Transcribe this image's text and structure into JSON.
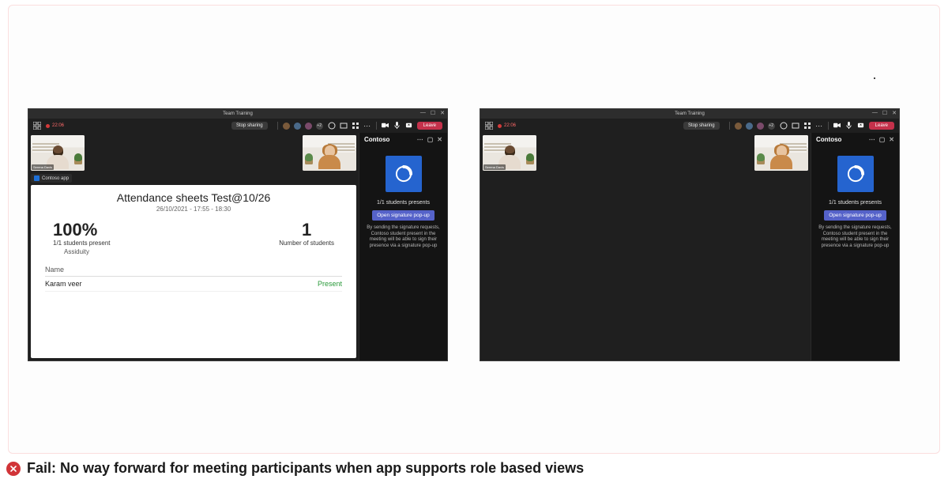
{
  "fail": {
    "text": "Fail: No way forward for meeting participants when app supports role based views"
  },
  "meeting": {
    "title": "Team Training",
    "timer": "22:06",
    "stopSharing": "Stop sharing",
    "leave": "Leave",
    "participantOverflow": "+2"
  },
  "participants": {
    "leftName": "Serena Davis"
  },
  "appTab": {
    "name": "Contoso app"
  },
  "attendance": {
    "title": "Attendance sheets Test@10/26",
    "dateRange": "26/10/2021 - 17:55 - 18:30",
    "percent": "100%",
    "percentLabel": "1/1 students present",
    "assiduity": "Assiduity",
    "count": "1",
    "countLabel": "Number of students",
    "colName": "Name",
    "rows": [
      {
        "name": "Karam veer",
        "status": "Present"
      }
    ]
  },
  "sidepanel": {
    "title": "Contoso",
    "summary": "1/1 students presents",
    "button": "Open signature pop-up",
    "description": "By sending the signature requests, Contoso student present in the meeting will be able to sign their presence via a signature pop-up"
  }
}
